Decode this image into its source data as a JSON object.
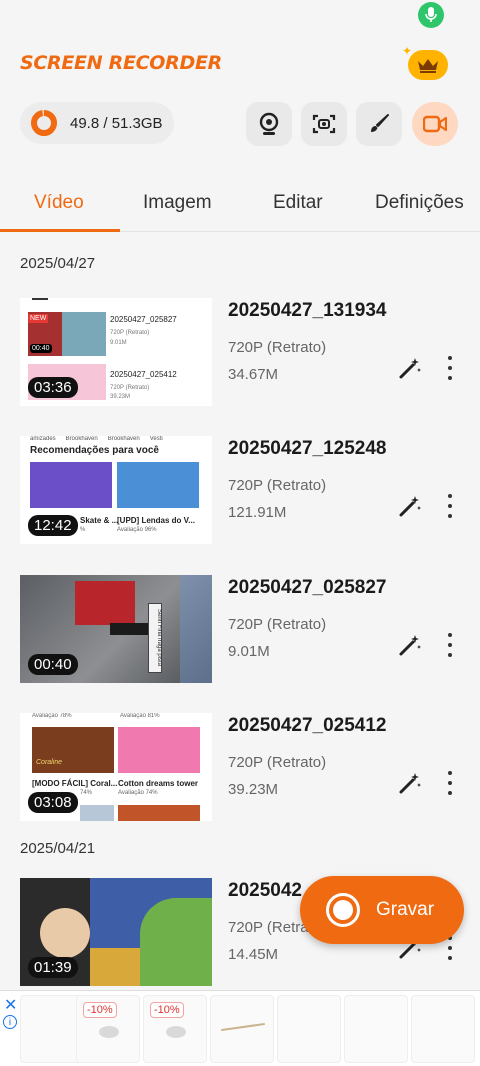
{
  "app": {
    "title": "SCREEN RECORDER",
    "storage": "49.8 / 51.3GB",
    "storage_used_fraction": 0.97,
    "accent": "#f06a12"
  },
  "toolbar": {
    "buttons": [
      {
        "name": "webcam-button",
        "icon": "webcam-icon"
      },
      {
        "name": "screenshot-button",
        "icon": "screenshot-icon"
      },
      {
        "name": "brush-button",
        "icon": "brush-icon"
      },
      {
        "name": "record-mode-button",
        "icon": "video-camera-icon"
      }
    ]
  },
  "tabs": [
    "Vídeo",
    "Imagem",
    "Editar",
    "Definições"
  ],
  "groups": [
    {
      "date": "2025/04/27"
    },
    {
      "date": "2025/04/21"
    }
  ],
  "videos": [
    {
      "title": "20250427_131934",
      "resolution": "720P (Retrato)",
      "size": "34.67M",
      "duration": "03:36"
    },
    {
      "title": "20250427_125248",
      "resolution": "720P (Retrato)",
      "size": "121.91M",
      "duration": "12:42"
    },
    {
      "title": "20250427_025827",
      "resolution": "720P (Retrato)",
      "size": "9.01M",
      "duration": "00:40"
    },
    {
      "title": "20250427_025412",
      "resolution": "720P (Retrato)",
      "size": "39.23M",
      "duration": "03:08"
    },
    {
      "title": "2025042",
      "resolution": "720P (Retra",
      "size": "14.45M",
      "duration": "01:39"
    }
  ],
  "thumbs": {
    "t1": {
      "new": "NEW",
      "a_title": "20250427_025827",
      "a_res": "720P (Retrato)",
      "a_size": "9.01M",
      "a_dur": "00:40",
      "b_title": "20250427_025412",
      "b_res": "720P (Retrato)",
      "b_size": "39.23M"
    },
    "t2": {
      "top": "amizades      Brookhaven      Brookhaven      Vesti",
      "heading": "Recomendações para você",
      "c1": "Skate & ...",
      "c2": "[UPD] Lendas do V...",
      "r1": "%",
      "r2": "Avaliação 96%"
    },
    "t3": {
      "sign": "Senh Fina fraga pista"
    },
    "t4": {
      "top1": "Avaliação 78%",
      "top2": "Avaliação 81%",
      "c1": "[MODO FÁCIL] Coral...",
      "c2": "Cotton dreams tower",
      "r1": "74%",
      "r2": "Avaliação 74%",
      "logo": "Coraline"
    }
  },
  "record_button": {
    "label": "Gravar"
  },
  "ad": {
    "close": "✕",
    "info": "i",
    "badges": [
      "-10%",
      "-10%"
    ]
  }
}
